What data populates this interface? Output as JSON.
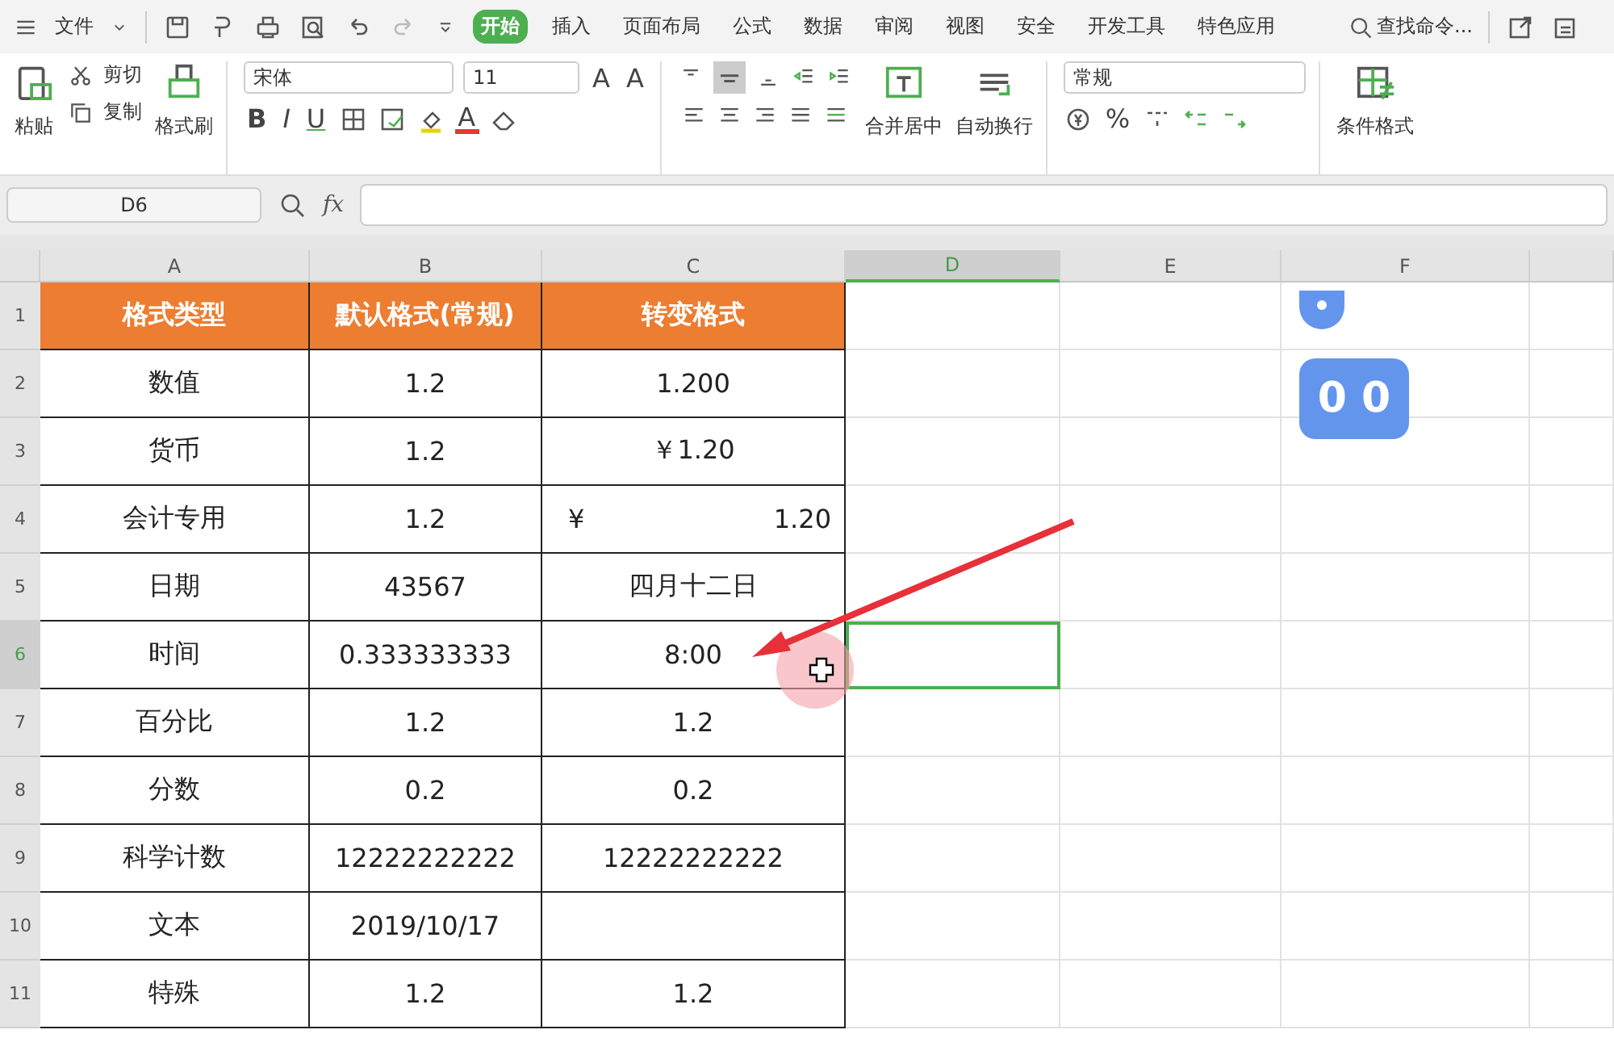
{
  "menu_bar": {
    "file_menu": "文件",
    "tabs": [
      {
        "label": "开始",
        "selected": true
      },
      {
        "label": "插入",
        "selected": false
      },
      {
        "label": "页面布局",
        "selected": false
      },
      {
        "label": "公式",
        "selected": false
      },
      {
        "label": "数据",
        "selected": false
      },
      {
        "label": "审阅",
        "selected": false
      },
      {
        "label": "视图",
        "selected": false
      },
      {
        "label": "安全",
        "selected": false
      },
      {
        "label": "开发工具",
        "selected": false
      },
      {
        "label": "特色应用",
        "selected": false
      }
    ],
    "search": "查找命令..."
  },
  "ribbon": {
    "paste": "粘贴",
    "cut": "剪切",
    "copy": "复制",
    "format_painter": "格式刷",
    "font_name": "宋体",
    "font_size": "11",
    "grow_font": "A",
    "shrink_font": "A",
    "bold": "B",
    "italic": "I",
    "underline": "U",
    "font_color": "A",
    "merge_center": "合并居中",
    "wrap_text": "自动换行",
    "number_format": "常规",
    "percent": "%",
    "conditional_format": "条件格式"
  },
  "formula_bar": {
    "cell_ref": "D6",
    "fx": "fx"
  },
  "sheet": {
    "columns": [
      {
        "label": "A",
        "selected": false
      },
      {
        "label": "B",
        "selected": false
      },
      {
        "label": "C",
        "selected": false
      },
      {
        "label": "D",
        "selected": true
      },
      {
        "label": "E",
        "selected": false
      },
      {
        "label": "F",
        "selected": false
      }
    ],
    "rows": [
      {
        "number": "1",
        "selected": false,
        "cells": [
          {
            "text": "格式类型"
          },
          {
            "text": "默认格式(常规)"
          },
          {
            "text": "转变格式"
          }
        ]
      },
      {
        "number": "2",
        "selected": false,
        "cells": [
          {
            "text": "数值"
          },
          {
            "text": "1.2"
          },
          {
            "text": "1.200"
          }
        ]
      },
      {
        "number": "3",
        "selected": false,
        "cells": [
          {
            "text": "货币"
          },
          {
            "text": "1.2"
          },
          {
            "text": "￥1.20"
          }
        ]
      },
      {
        "number": "4",
        "selected": false,
        "cells": [
          {
            "text": "会计专用"
          },
          {
            "text": "1.2"
          },
          {
            "symbol": "¥",
            "text": "1.20"
          }
        ]
      },
      {
        "number": "5",
        "selected": false,
        "cells": [
          {
            "text": "日期"
          },
          {
            "text": "43567"
          },
          {
            "text": "四月十二日"
          }
        ]
      },
      {
        "number": "6",
        "selected": true,
        "cells": [
          {
            "text": "时间"
          },
          {
            "text": "0.333333333"
          },
          {
            "text": "8:00"
          }
        ]
      },
      {
        "number": "7",
        "selected": false,
        "cells": [
          {
            "text": "百分比"
          },
          {
            "text": "1.2"
          },
          {
            "text": "1.2"
          }
        ]
      },
      {
        "number": "8",
        "selected": false,
        "cells": [
          {
            "text": "分数"
          },
          {
            "text": "0.2"
          },
          {
            "text": "0.2"
          }
        ]
      },
      {
        "number": "9",
        "selected": false,
        "cells": [
          {
            "text": "科学计数"
          },
          {
            "text": "12222222222"
          },
          {
            "text": "12222222222"
          }
        ]
      },
      {
        "number": "10",
        "selected": false,
        "cells": [
          {
            "text": "文本"
          },
          {
            "text": "2019/10/17"
          },
          {
            "text": ""
          }
        ]
      },
      {
        "number": "11",
        "selected": false,
        "cells": [
          {
            "text": "特殊"
          },
          {
            "text": "1.2"
          },
          {
            "text": "1.2"
          }
        ]
      }
    ]
  },
  "floating_widget": {
    "text": "0 0"
  }
}
